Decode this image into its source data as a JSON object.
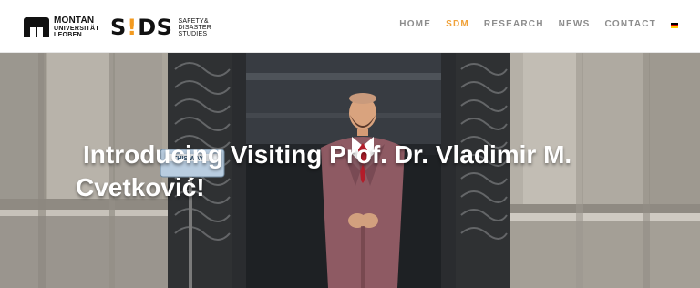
{
  "brand": {
    "mu": {
      "line1": "MONTAN",
      "line2": "UNIVERSITÄT",
      "line3": "LEOBEN"
    },
    "sds": {
      "wordmark_left": "S",
      "wordmark_exclaim": "!",
      "wordmark_right": "DS",
      "line1": "SAFETY&",
      "line2": "DISASTER",
      "line3": "STUDIES",
      "accent_color": "#f39a1f"
    }
  },
  "nav": {
    "items": [
      {
        "label": "HOME"
      },
      {
        "label": "SDM",
        "active": true
      },
      {
        "label": "RESEARCH"
      },
      {
        "label": "NEWS"
      },
      {
        "label": "CONTACT"
      }
    ],
    "language_flag": "de-flag",
    "active_color": "#f0a23a",
    "inactive_color": "#8c8c8c"
  },
  "hero": {
    "title_line1": "Introducing Visiting Prof. Dr. Vladimir M.",
    "title_line2": "Cvetković!",
    "sign_text": "THIS WAY"
  }
}
